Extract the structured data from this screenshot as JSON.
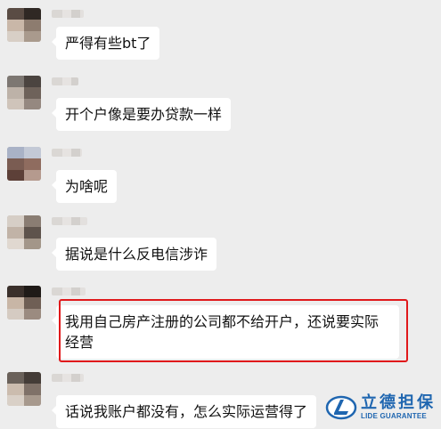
{
  "messages": [
    {
      "text": "严得有些bt了"
    },
    {
      "text": "开个户像是要办贷款一样"
    },
    {
      "text": "为啥呢"
    },
    {
      "text": "据说是什么反电信涉诈"
    },
    {
      "text": "我用自己房产注册的公司都不给开户，还说要实际经营"
    },
    {
      "text": "话说我账户都没有，怎么实际运营得了"
    }
  ],
  "watermark": {
    "cn": "立德担保",
    "en": "LIDE GUARANTEE"
  },
  "colors": {
    "background": "#ededed",
    "bubble": "#ffffff",
    "highlight_border": "#e0191b",
    "watermark_blue": "#1f66b0"
  }
}
